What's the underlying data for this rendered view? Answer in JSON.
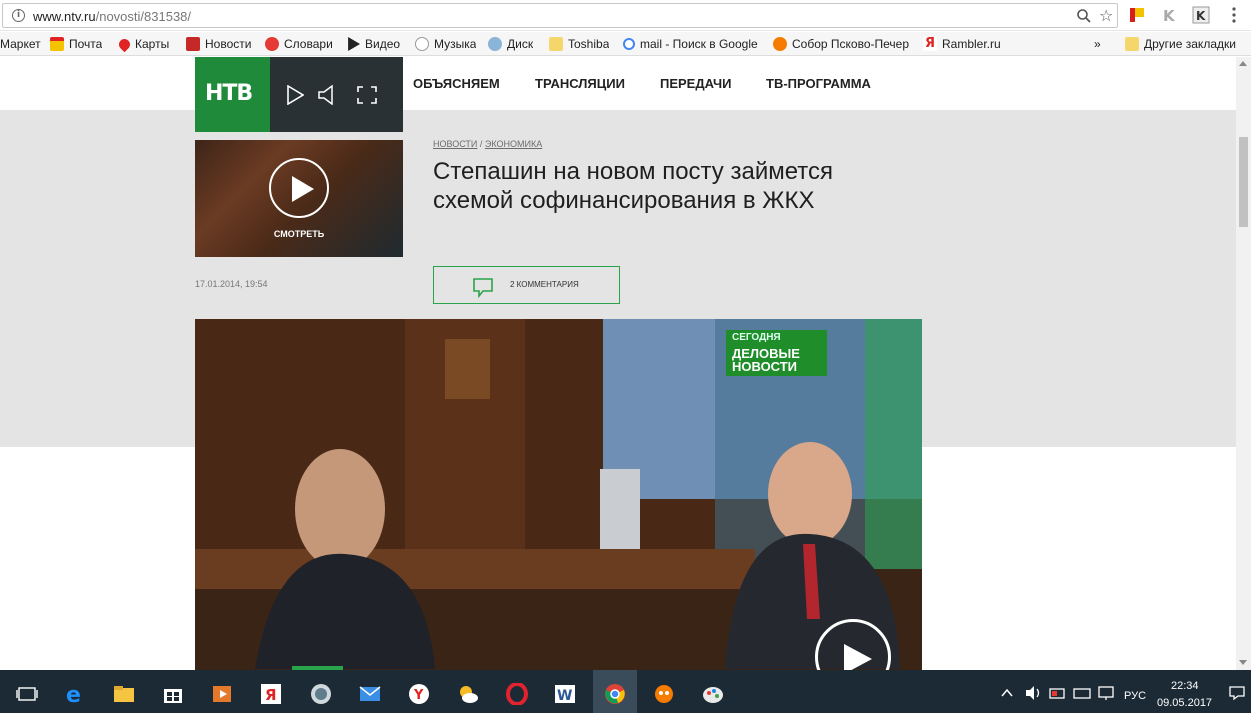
{
  "browser": {
    "url_host": "www.ntv.ru",
    "url_path": "/novosti/831538/"
  },
  "bookmarks": [
    {
      "label": "Маркет",
      "icon": "market-icon"
    },
    {
      "label": "Почта",
      "icon": "mail-icon"
    },
    {
      "label": "Карты",
      "icon": "maps-icon"
    },
    {
      "label": "Новости",
      "icon": "news-icon"
    },
    {
      "label": "Словари",
      "icon": "dictionary-icon"
    },
    {
      "label": "Видео",
      "icon": "video-icon"
    },
    {
      "label": "Музыка",
      "icon": "music-icon"
    },
    {
      "label": "Диск",
      "icon": "disk-icon"
    },
    {
      "label": "Toshiba",
      "icon": "folder-icon"
    },
    {
      "label": "mail - Поиск в Google",
      "icon": "google-icon"
    },
    {
      "label": "Собор Псково-Печер",
      "icon": "site-icon"
    },
    {
      "label": "Rambler.ru",
      "icon": "rambler-icon"
    }
  ],
  "bookmarks_overflow": "»",
  "other_bookmarks": "Другие закладки",
  "site": {
    "logo": "НТВ",
    "nav": [
      "ОБЪЯСНЯЕМ",
      "ТРАНСЛЯЦИИ",
      "ПЕРЕДАЧИ",
      "ТВ-ПРОГРАММА"
    ]
  },
  "article": {
    "crumb_1": "НОВОСТИ",
    "crumb_sep": " / ",
    "crumb_2": "ЭКОНОМИКА",
    "title": "Степашин на новом посту займется схемой софинансирования в ЖКХ",
    "date": "17.01.2014, 19:54",
    "thumb_label": "СМОТРЕТЬ",
    "comments": "2 КОММЕНТАРИЯ"
  },
  "video": {
    "badge_small": "СЕГОДНЯ",
    "badge_line1": "ДЕЛОВЫЕ",
    "badge_line2": "НОВОСТИ"
  },
  "taskbar": {
    "lang": "РУС",
    "time": "22:34",
    "date": "09.05.2017"
  },
  "colors": {
    "brand_green": "#1e8a3a",
    "band_gray": "#e4e4e4",
    "taskbar": "#1c2a35"
  }
}
